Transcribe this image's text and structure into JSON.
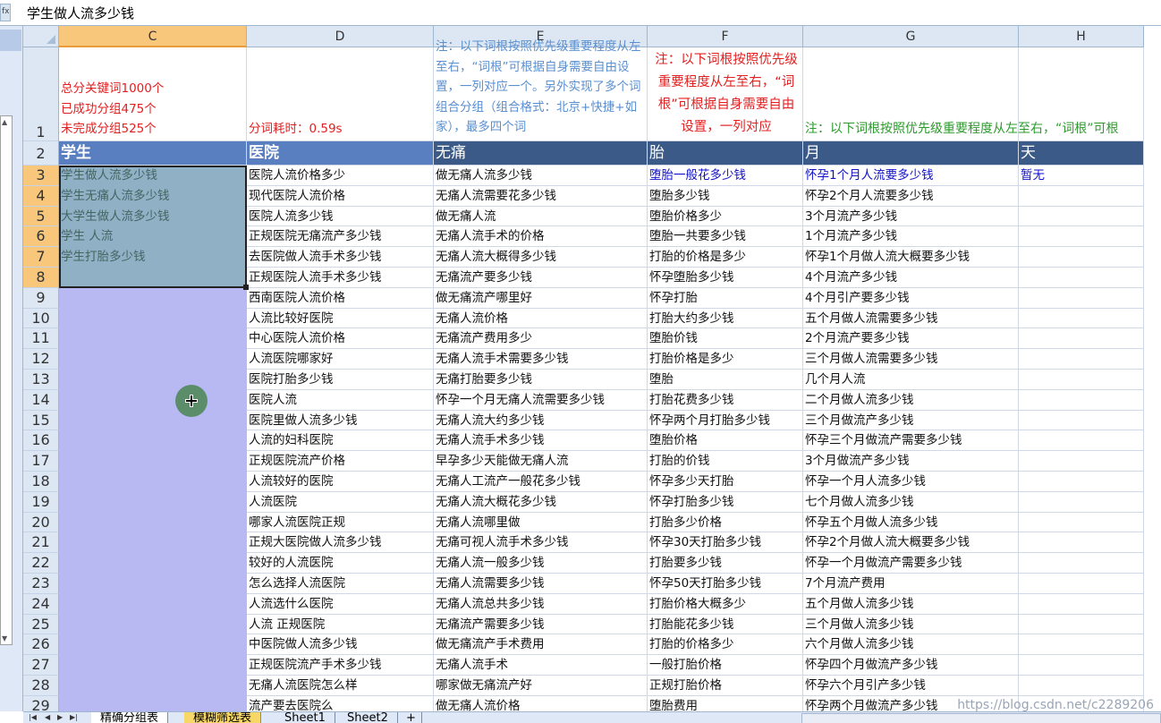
{
  "formula_bar": {
    "icon": "fx-icon",
    "content": "学生做人流多少钱"
  },
  "columns": [
    {
      "label": "C",
      "selected": true
    },
    {
      "label": "D",
      "selected": false
    },
    {
      "label": "E",
      "selected": false
    },
    {
      "label": "F",
      "selected": false
    },
    {
      "label": "G",
      "selected": false
    },
    {
      "label": "H",
      "selected": false
    }
  ],
  "rows": [
    "1",
    "2",
    "3",
    "4",
    "5",
    "6",
    "7",
    "8",
    "9",
    "10",
    "11",
    "12",
    "13",
    "14",
    "15",
    "16",
    "17",
    "18",
    "19",
    "20",
    "21",
    "22",
    "23",
    "24",
    "25",
    "26",
    "27",
    "28",
    "29"
  ],
  "row1": {
    "C_lines": [
      "总分关键词1000个",
      "已成功分组475个",
      "未完成分组525个"
    ],
    "D": "分词耗时：0.59s",
    "E": "注：以下词根按照优先级重要程度从左至右，“词根”可根据自身需要自由设置，一列对应一个。另外实现了多个词组合分组（组合格式：北京+快捷+如家），最多四个词",
    "F": "注：以下词根按照优先级重要程度从左至右，“词根”可根据自身需要自由设置，一列对应",
    "G": "注：以下词根按照优先级重要程度从左至右，“词根”可根"
  },
  "headers_row2": [
    "学生",
    "医院",
    "无痛",
    "胎",
    "月",
    "天"
  ],
  "col_C": [
    "学生做人流多少钱",
    "学生无痛人流多少钱",
    "大学生做人流多少钱",
    "学生 人流",
    "学生打胎多少钱"
  ],
  "col_D": [
    "医院人流价格多少",
    "现代医院人流价格",
    "医院人流多少钱",
    "正规医院无痛流产多少钱",
    "去医院做人流手术多少钱",
    "正规医院人流手术多少钱",
    "西南医院人流价格",
    "人流比较好医院",
    "中心医院人流价格",
    "人流医院哪家好",
    "医院打胎多少钱",
    "医院人流",
    "医院里做人流多少钱",
    "人流的妇科医院",
    "正规医院流产价格",
    "人流较好的医院",
    "人流医院",
    "哪家人流医院正规",
    "正规大医院做人流多少钱",
    "较好的人流医院",
    "怎么选择人流医院",
    "人流选什么医院",
    "人流 正规医院",
    "中医院做人流多少钱",
    "正规医院流产手术多少钱",
    "无痛人流医院怎么样",
    "流产要去医院么"
  ],
  "col_E": [
    "做无痛人流多少钱",
    "无痛人流需要花多少钱",
    "做无痛人流",
    "无痛人流手术的价格",
    "无痛人流大概得多少钱",
    "无痛流产要多少钱",
    "做无痛流产哪里好",
    "无痛人流价格",
    "无痛流产费用多少",
    "无痛人流手术需要多少钱",
    "无痛打胎要多少钱",
    "怀孕一个月无痛人流需要多少钱",
    "无痛人流大约多少钱",
    "无痛人流手术多少钱",
    "早孕多少天能做无痛人流",
    "无痛人工流产一般花多少钱",
    "无痛人流大概花多少钱",
    "无痛人流哪里做",
    "无痛可视人流手术多少钱",
    "无痛人流一般多少钱",
    "无痛人流需要多少钱",
    "无痛人流总共多少钱",
    "无痛流产需要多少钱",
    "做无痛流产手术费用",
    "无痛人流手术",
    "哪家做无痛流产好",
    "做无痛人流价格"
  ],
  "col_F": [
    "堕胎一般花多少钱",
    "堕胎多少钱",
    "堕胎价格多少",
    "堕胎一共要多少钱",
    "打胎的价格是多少",
    "怀孕堕胎多少钱",
    "怀孕打胎",
    "打胎大约多少钱",
    "堕胎价钱",
    "打胎价格是多少",
    "堕胎",
    "打胎花费多少钱",
    "怀孕两个月打胎多少钱",
    "堕胎价格",
    "打胎的价钱",
    "怀孕多少天打胎",
    "怀孕打胎多少钱",
    "打胎多少价格",
    "怀孕30天打胎多少钱",
    "打胎要多少钱",
    "怀孕50天打胎多少钱",
    "打胎价格大概多少",
    "打胎能花多少钱",
    "打胎的价格多少",
    "一般打胎价格",
    "正规打胎价格",
    "堕胎费用"
  ],
  "col_G": [
    "怀孕1个月人流要多少钱",
    "怀孕2个月人流要多少钱",
    "3个月流产多少钱",
    "1个月流产多少钱",
    "怀孕1个月做人流大概要多少钱",
    "4个月流产多少钱",
    "4个月引产要多少钱",
    "五个月做人流需要多少钱",
    "2个月流产要多少钱",
    "三个月做人流需要多少钱",
    "几个月人流",
    "二个月做人流多少钱",
    "三个月做流产多少钱",
    "怀孕三个月做流产需要多少钱",
    "3个月做流产多少钱",
    "怀孕一个月人流多少钱",
    "七个月做人流多少钱",
    "怀孕五个月做人流多少钱",
    "怀孕2个月做人流大概要多少钱",
    "怀孕一个月做流产需要多少钱",
    "7个月流产费用",
    "五个月做人流多少钱",
    "三个月做人流多少钱",
    "六个月做人流多少钱",
    "怀孕四个月做流产多少钱",
    "怀孕六个月引产多少钱",
    "怀孕两个月做流产多少钱"
  ],
  "col_H": [
    "暂无"
  ],
  "tabs": [
    "精确分组表",
    "模糊筛选表",
    "Sheet1",
    "Sheet2"
  ],
  "watermark": "https://blog.csdn.net/c2289206",
  "colors": {
    "header_bar": "#3c5a87",
    "colC_fill": "#b8b8f2",
    "red_note": "#e32020",
    "blue_note": "#5a8fd0",
    "green_note": "#2c9b2c",
    "blue_text": "#1010c8"
  }
}
